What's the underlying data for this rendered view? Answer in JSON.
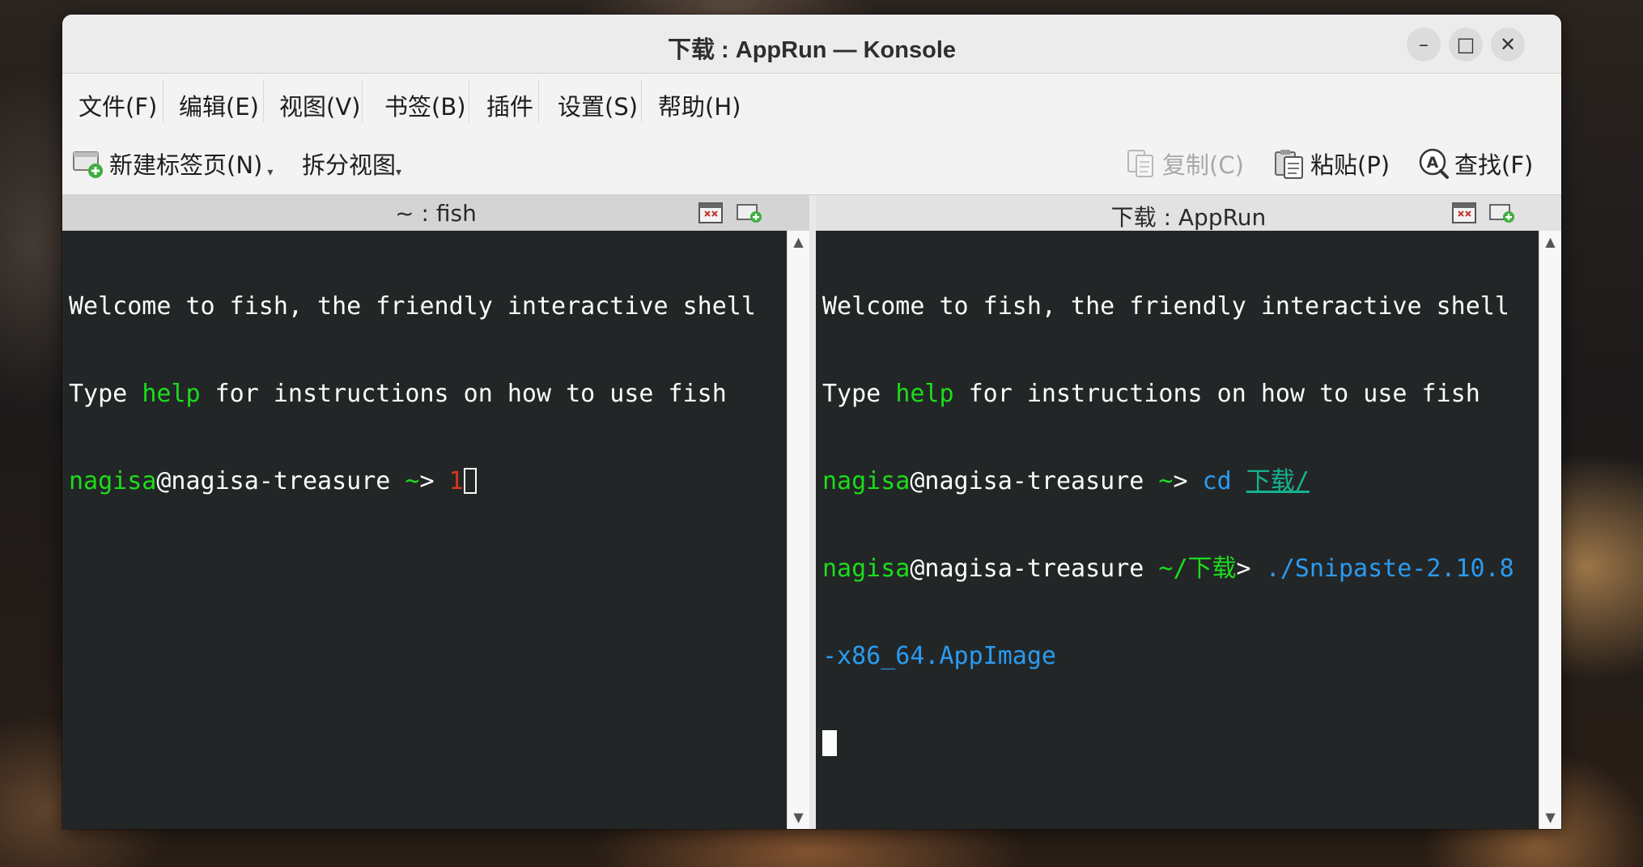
{
  "window": {
    "title": "下载 : AppRun — Konsole",
    "minimize_glyph": "–",
    "maximize_glyph": "□",
    "close_glyph": "✕"
  },
  "menubar": {
    "items": [
      "文件(F)",
      "编辑(E)",
      "视图(V)",
      "书签(B)",
      "插件",
      "设置(S)",
      "帮助(H)"
    ]
  },
  "toolbar": {
    "new_tab_label": "新建标签页(N)",
    "split_view_label": "拆分视图",
    "copy_label": "复制(C)",
    "paste_label": "粘贴(P)",
    "find_label": "查找(F)",
    "copy_enabled": false
  },
  "left_pane": {
    "title": "~ : fish",
    "active": false,
    "lines": {
      "l1": "Welcome to fish, the friendly interactive shell",
      "l2_a": "Type ",
      "l2_b": "help",
      "l2_c": " for instructions on how to use fish",
      "prompt_user": "nagisa",
      "prompt_host": "@nagisa-treasure",
      "prompt_path": " ~",
      "prompt_arrow": "> ",
      "typed": "1"
    }
  },
  "right_pane": {
    "title": "下载 : AppRun",
    "active": true,
    "lines": {
      "l1": "Welcome to fish, the friendly interactive shell",
      "l2_a": "Type ",
      "l2_b": "help",
      "l2_c": " for instructions on how to use fish",
      "p1_user": "nagisa",
      "p1_host": "@nagisa-treasure",
      "p1_path": " ~",
      "p1_arrow": "> ",
      "p1_cmd": "cd",
      "p1_space": " ",
      "p1_arg": "下载/",
      "p2_user": "nagisa",
      "p2_host": "@nagisa-treasure",
      "p2_path": " ~/下载",
      "p2_arrow": "> ",
      "p2_cmd_a": "./Snipaste-2.10.8",
      "p2_cmd_b": "-x86_64.AppImage"
    }
  },
  "colors": {
    "terminal_bg": "#232627",
    "terminal_fg": "#fcfcfc",
    "prompt_green": "#1cdc1c",
    "path_teal": "#14b38f",
    "command_blue": "#2a9bf0",
    "error_red": "#d4371c"
  },
  "icons": {
    "new_tab": "new-tab-icon",
    "copy": "copy-icon",
    "paste": "paste-icon",
    "find": "find-icon",
    "close_pane": "close-pane-icon",
    "add_pane": "add-pane-icon"
  }
}
